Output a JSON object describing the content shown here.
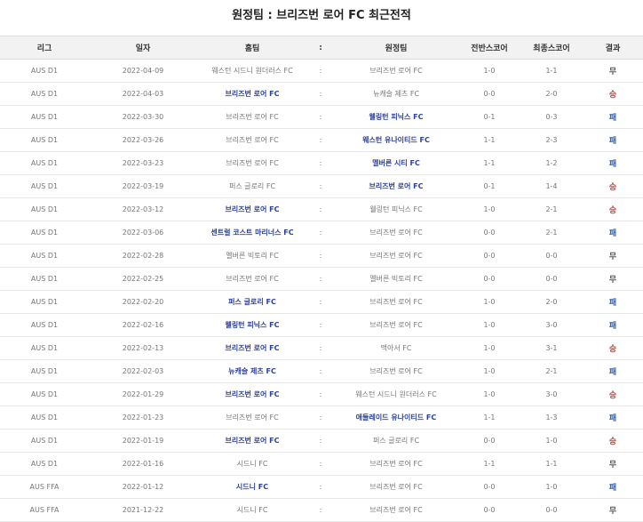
{
  "title": "원정팀 : 브리즈번 로어 FC 최근전적",
  "headers": {
    "league": "리그",
    "date": "일자",
    "home": "홈팀",
    "colon": ":",
    "away": "원정팀",
    "half": "전반스코어",
    "final": "최종스코어",
    "result": "결과"
  },
  "colors": {
    "win_team": "#2b3f9e",
    "result_win": "#d63a2a",
    "result_loss": "#2d5fb8",
    "result_draw": "#555555"
  },
  "rows": [
    {
      "league": "AUS D1",
      "date": "2022-04-09",
      "home": "웨스턴 시드니 원더러스 FC",
      "away": "브리즈번 로어 FC",
      "half": "1-0",
      "final": "1-1",
      "result": "무",
      "winner": "",
      "rtype": "draw"
    },
    {
      "league": "AUS D1",
      "date": "2022-04-03",
      "home": "브리즈번 로어 FC",
      "away": "뉴캐슬 제츠 FC",
      "half": "0-0",
      "final": "2-0",
      "result": "승",
      "winner": "home",
      "rtype": "win"
    },
    {
      "league": "AUS D1",
      "date": "2022-03-30",
      "home": "브리즈번 로어 FC",
      "away": "웰링턴 피닉스 FC",
      "half": "0-1",
      "final": "0-3",
      "result": "패",
      "winner": "away",
      "rtype": "loss"
    },
    {
      "league": "AUS D1",
      "date": "2022-03-26",
      "home": "브리즈번 로어 FC",
      "away": "웨스턴 유나이티드 FC",
      "half": "1-1",
      "final": "2-3",
      "result": "패",
      "winner": "away",
      "rtype": "loss"
    },
    {
      "league": "AUS D1",
      "date": "2022-03-23",
      "home": "브리즈번 로어 FC",
      "away": "멜버른 시티 FC",
      "half": "1-1",
      "final": "1-2",
      "result": "패",
      "winner": "away",
      "rtype": "loss"
    },
    {
      "league": "AUS D1",
      "date": "2022-03-19",
      "home": "퍼스 글로리 FC",
      "away": "브리즈번 로어 FC",
      "half": "0-1",
      "final": "1-4",
      "result": "승",
      "winner": "away",
      "rtype": "win"
    },
    {
      "league": "AUS D1",
      "date": "2022-03-12",
      "home": "브리즈번 로어 FC",
      "away": "웰링턴 피닉스 FC",
      "half": "1-0",
      "final": "2-1",
      "result": "승",
      "winner": "home",
      "rtype": "win"
    },
    {
      "league": "AUS D1",
      "date": "2022-03-06",
      "home": "센트럴 코스트 마리너스 FC",
      "away": "브리즈번 로어 FC",
      "half": "0-0",
      "final": "2-1",
      "result": "패",
      "winner": "home",
      "rtype": "loss"
    },
    {
      "league": "AUS D1",
      "date": "2022-02-28",
      "home": "멜버른 빅토리 FC",
      "away": "브리즈번 로어 FC",
      "half": "0-0",
      "final": "0-0",
      "result": "무",
      "winner": "",
      "rtype": "draw"
    },
    {
      "league": "AUS D1",
      "date": "2022-02-25",
      "home": "브리즈번 로어 FC",
      "away": "멜버른 빅토리 FC",
      "half": "0-0",
      "final": "0-0",
      "result": "무",
      "winner": "",
      "rtype": "draw"
    },
    {
      "league": "AUS D1",
      "date": "2022-02-20",
      "home": "퍼스 글로리 FC",
      "away": "브리즈번 로어 FC",
      "half": "1-0",
      "final": "2-0",
      "result": "패",
      "winner": "home",
      "rtype": "loss"
    },
    {
      "league": "AUS D1",
      "date": "2022-02-16",
      "home": "웰링턴 피닉스 FC",
      "away": "브리즈번 로어 FC",
      "half": "1-0",
      "final": "3-0",
      "result": "패",
      "winner": "home",
      "rtype": "loss"
    },
    {
      "league": "AUS D1",
      "date": "2022-02-13",
      "home": "브리즈번 로어 FC",
      "away": "맥아서 FC",
      "half": "1-0",
      "final": "3-1",
      "result": "승",
      "winner": "home",
      "rtype": "win"
    },
    {
      "league": "AUS D1",
      "date": "2022-02-03",
      "home": "뉴캐슬 제츠 FC",
      "away": "브리즈번 로어 FC",
      "half": "1-0",
      "final": "2-1",
      "result": "패",
      "winner": "home",
      "rtype": "loss"
    },
    {
      "league": "AUS D1",
      "date": "2022-01-29",
      "home": "브리즈번 로어 FC",
      "away": "웨스턴 시드니 원더러스 FC",
      "half": "1-0",
      "final": "3-0",
      "result": "승",
      "winner": "home",
      "rtype": "win"
    },
    {
      "league": "AUS D1",
      "date": "2022-01-23",
      "home": "브리즈번 로어 FC",
      "away": "애들레이드 유나이티드 FC",
      "half": "1-1",
      "final": "1-3",
      "result": "패",
      "winner": "away",
      "rtype": "loss"
    },
    {
      "league": "AUS D1",
      "date": "2022-01-19",
      "home": "브리즈번 로어 FC",
      "away": "퍼스 글로리 FC",
      "half": "0-0",
      "final": "1-0",
      "result": "승",
      "winner": "home",
      "rtype": "win"
    },
    {
      "league": "AUS D1",
      "date": "2022-01-16",
      "home": "시드니 FC",
      "away": "브리즈번 로어 FC",
      "half": "1-1",
      "final": "1-1",
      "result": "무",
      "winner": "",
      "rtype": "draw"
    },
    {
      "league": "AUS FFA",
      "date": "2022-01-12",
      "home": "시드니 FC",
      "away": "브리즈번 로어 FC",
      "half": "0-0",
      "final": "1-0",
      "result": "패",
      "winner": "home",
      "rtype": "loss"
    },
    {
      "league": "AUS FFA",
      "date": "2021-12-22",
      "home": "시드니 FC",
      "away": "브리즈번 로어 FC",
      "half": "0-0",
      "final": "0-0",
      "result": "무",
      "winner": "",
      "rtype": "draw"
    }
  ]
}
